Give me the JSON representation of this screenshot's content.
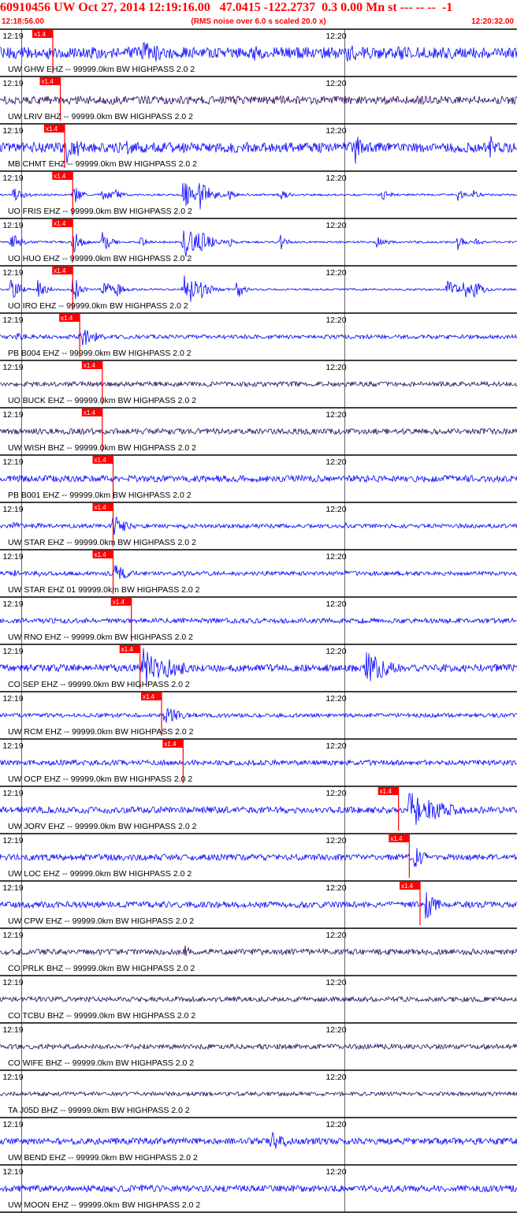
{
  "header": {
    "title": "60910456 UW Oct 27, 2014 12:19:16.00   47.0415 -122.2737  0.3 0.00 Mn st --- -- --  -1",
    "start_time": "12:18:56.00",
    "subtitle": "(RMS noise over 6.0 s scaled 20.0 x)",
    "end_time": "12:20:32.00"
  },
  "colors": {
    "header": "#ff0000",
    "trace_blue": "#0000ff",
    "trace_dark": "#2a0a5e",
    "pick": "#ff0000"
  },
  "chart_data": {
    "type": "line",
    "xlabel": "",
    "ylabel": "",
    "x_range": [
      "12:18:56.00",
      "12:20:32.00"
    ],
    "time_ticks": [
      {
        "label": "12:19",
        "time": "12:19:00"
      },
      {
        "label": "12:20",
        "time": "12:20:00"
      }
    ],
    "pick_label": "x1.4",
    "series": [
      {
        "name": "UW GHW EHZ -- 99999.0km BW HIGHPASS  2.0  2",
        "pick_time": "12:19:05.8",
        "color": "blue",
        "amp": 0.28,
        "events": [
          [
            "12:19:04.7",
            0.4,
            1.5
          ],
          [
            "12:19:22",
            0.7,
            3.0
          ],
          [
            "12:19:32",
            0.4,
            2.0
          ],
          [
            "12:19:43",
            0.4,
            2.5
          ],
          [
            "12:20:00",
            0.5,
            3.0
          ],
          [
            "12:20:10",
            0.4,
            3.0
          ],
          [
            "12:20:20",
            0.3,
            3.0
          ]
        ]
      },
      {
        "name": "UW LRIV BHZ -- 99999.0km BW HIGHPASS  2.0  2",
        "pick_time": "12:19:07.2",
        "color": "dark",
        "amp": 0.2,
        "events": []
      },
      {
        "name": "MB CHMT EHZ -- 99999.0km BW HIGHPASS  2.0  2",
        "pick_time": "12:19:08.0",
        "color": "blue",
        "amp": 0.25,
        "events": [
          [
            "12:19:08.5",
            1.0,
            0.6
          ],
          [
            "12:19:10",
            0.6,
            0.8
          ],
          [
            "12:19:19.5",
            0.6,
            0.6
          ],
          [
            "12:20:02",
            0.8,
            0.5
          ],
          [
            "12:20:27",
            0.8,
            0.5
          ]
        ]
      },
      {
        "name": "UO FRIS EHZ -- 99999.0km BW HIGHPASS  2.0  2",
        "pick_time": "12:19:09.5",
        "color": "blue",
        "amp": 0.05,
        "events": [
          [
            "12:18:58.5",
            0.5,
            0.8
          ],
          [
            "12:19:09.5",
            0.6,
            0.6
          ],
          [
            "12:19:15",
            0.5,
            0.8
          ],
          [
            "12:19:17.5",
            0.3,
            0.6
          ],
          [
            "12:19:30",
            0.8,
            1.0
          ],
          [
            "12:19:33",
            0.8,
            1.0
          ],
          [
            "12:19:38.5",
            0.3,
            0.5
          ],
          [
            "12:19:48",
            0.5,
            0.5
          ],
          [
            "12:20:07",
            0.3,
            0.8
          ],
          [
            "12:20:21",
            0.3,
            0.6
          ],
          [
            "12:20:24",
            0.3,
            0.6
          ]
        ]
      },
      {
        "name": "UO HUO EHZ -- 99999.0km BW HIGHPASS  2.0  2",
        "pick_time": "12:19:09.5",
        "color": "blue",
        "amp": 0.05,
        "events": [
          [
            "12:18:58",
            0.5,
            0.8
          ],
          [
            "12:19:09.5",
            0.7,
            0.6
          ],
          [
            "12:19:15",
            0.5,
            0.8
          ],
          [
            "12:19:22",
            0.3,
            0.6
          ],
          [
            "12:19:30",
            1.0,
            1.2
          ],
          [
            "12:19:33",
            0.8,
            1.0
          ],
          [
            "12:19:38.5",
            0.3,
            0.5
          ],
          [
            "12:19:48",
            0.5,
            0.5
          ],
          [
            "12:20:06",
            0.3,
            0.8
          ],
          [
            "12:20:21",
            0.4,
            0.6
          ],
          [
            "12:20:24",
            0.3,
            0.6
          ]
        ]
      },
      {
        "name": "UO IRO EHZ -- 99999.0km BW HIGHPASS  2.0  2",
        "pick_time": "12:19:09.5",
        "color": "blue",
        "amp": 0.05,
        "events": [
          [
            "12:18:58",
            0.6,
            0.8
          ],
          [
            "12:19:03",
            0.5,
            0.8
          ],
          [
            "12:19:09.5",
            0.8,
            0.6
          ],
          [
            "12:19:15",
            0.6,
            0.8
          ],
          [
            "12:19:17.5",
            0.5,
            0.6
          ],
          [
            "12:19:30",
            1.0,
            1.4
          ],
          [
            "12:19:33",
            0.6,
            1.0
          ],
          [
            "12:19:40",
            0.6,
            0.5
          ],
          [
            "12:20:19",
            0.5,
            1.0
          ],
          [
            "12:20:22",
            0.5,
            1.0
          ],
          [
            "12:20:24",
            0.5,
            0.8
          ]
        ]
      },
      {
        "name": "PB B004 EHZ -- 99999.0km BW HIGHPASS  2.0  2",
        "pick_time": "12:19:10.8",
        "color": "blue",
        "amp": 0.1,
        "events": [
          [
            "12:19:10.8",
            0.6,
            1.5
          ],
          [
            "12:18:59",
            0.2,
            2.0
          ]
        ]
      },
      {
        "name": "UO BUCK EHZ -- 99999.0km BW HIGHPASS  2.0  2",
        "pick_time": "12:19:15.0",
        "color": "dark",
        "amp": 0.12,
        "events": []
      },
      {
        "name": "UW WISH BHZ -- 99999.0km BW HIGHPASS  2.0  2",
        "pick_time": "12:19:15.0",
        "color": "dark",
        "amp": 0.14,
        "events": []
      },
      {
        "name": "PB B001 EHZ -- 99999.0km BW HIGHPASS  2.0  2",
        "pick_time": "12:19:17.0",
        "color": "blue",
        "amp": 0.16,
        "events": []
      },
      {
        "name": "UW STAR EHZ -- 99999.0km BW HIGHPASS  2.0  2",
        "pick_time": "12:19:17.0",
        "color": "blue",
        "amp": 0.1,
        "events": [
          [
            "12:19:17.0",
            0.6,
            1.2
          ],
          [
            "12:18:58.5",
            0.3,
            0.6
          ],
          [
            "12:19:03",
            0.2,
            0.8
          ],
          [
            "12:19:30",
            0.2,
            0.6
          ],
          [
            "12:20:00",
            0.2,
            0.6
          ]
        ]
      },
      {
        "name": "UW STAR EHZ 01 99999.0km BW HIGHPASS  2.0  2",
        "pick_time": "12:19:17.0",
        "color": "blue",
        "amp": 0.1,
        "events": [
          [
            "12:19:17.0",
            0.6,
            1.2
          ],
          [
            "12:18:58.5",
            0.3,
            0.6
          ],
          [
            "12:19:03",
            0.2,
            0.8
          ],
          [
            "12:19:30",
            0.2,
            0.6
          ],
          [
            "12:20:00",
            0.2,
            0.6
          ]
        ]
      },
      {
        "name": "UW RNO EHZ -- 99999.0km BW HIGHPASS  2.0  2",
        "pick_time": "12:19:20.4",
        "color": "blue",
        "amp": 0.12,
        "events": []
      },
      {
        "name": "CO SEP EHZ -- 99999.0km BW HIGHPASS  2.0  2",
        "pick_time": "12:19:22.0",
        "color": "blue",
        "amp": 0.18,
        "events": [
          [
            "12:19:22.5",
            1.0,
            3.0
          ],
          [
            "12:20:04",
            0.8,
            2.5
          ]
        ]
      },
      {
        "name": "UW RCM EHZ -- 99999.0km BW HIGHPASS  2.0  2",
        "pick_time": "12:19:26.0",
        "color": "blue",
        "amp": 0.1,
        "events": [
          [
            "12:19:26.5",
            0.5,
            1.5
          ]
        ]
      },
      {
        "name": "UW OCP EHZ -- 99999.0km BW HIGHPASS  2.0  2",
        "pick_time": "12:19:30.0",
        "color": "blue",
        "amp": 0.13,
        "events": []
      },
      {
        "name": "UW JORV EHZ -- 99999.0km BW HIGHPASS  2.0  2",
        "pick_time": "12:20:10.0",
        "color": "blue",
        "amp": 0.16,
        "events": [
          [
            "12:20:12",
            1.0,
            3.0
          ]
        ]
      },
      {
        "name": "UW LOC EHZ -- 99999.0km BW HIGHPASS  2.0  2",
        "pick_time": "12:20:12.0",
        "color": "blue",
        "amp": 0.15,
        "events": [
          [
            "12:20:13",
            0.6,
            1.0
          ]
        ]
      },
      {
        "name": "UW CPW EHZ -- 99999.0km BW HIGHPASS  2.0  2",
        "pick_time": "12:20:14.0",
        "color": "blue",
        "amp": 0.15,
        "events": [
          [
            "12:20:15",
            1.0,
            0.8
          ]
        ]
      },
      {
        "name": "CO PRLK BHZ -- 99999.0km BW HIGHPASS  2.0  2",
        "pick_time": "",
        "color": "dark",
        "amp": 0.14,
        "events": [
          [
            "12:19:30",
            0.4,
            0.8
          ]
        ]
      },
      {
        "name": "CO TCBU BHZ -- 99999.0km BW HIGHPASS  2.0  2",
        "pick_time": "",
        "color": "dark",
        "amp": 0.12,
        "events": []
      },
      {
        "name": "CO WIFE BHZ -- 99999.0km BW HIGHPASS  2.0  2",
        "pick_time": "",
        "color": "dark",
        "amp": 0.12,
        "events": []
      },
      {
        "name": "TA J05D BHZ -- 99999.0km BW HIGHPASS  2.0  2",
        "pick_time": "",
        "color": "dark",
        "amp": 0.1,
        "events": []
      },
      {
        "name": "UW BEND EHZ -- 99999.0km BW HIGHPASS  2.0  2",
        "pick_time": "",
        "color": "blue",
        "amp": 0.16,
        "events": [
          [
            "12:19:46",
            0.5,
            2.0
          ]
        ]
      },
      {
        "name": "UW MOON EHZ -- 99999.0km BW HIGHPASS  2.0  2",
        "pick_time": "",
        "color": "blue",
        "amp": 0.16,
        "events": []
      }
    ]
  }
}
